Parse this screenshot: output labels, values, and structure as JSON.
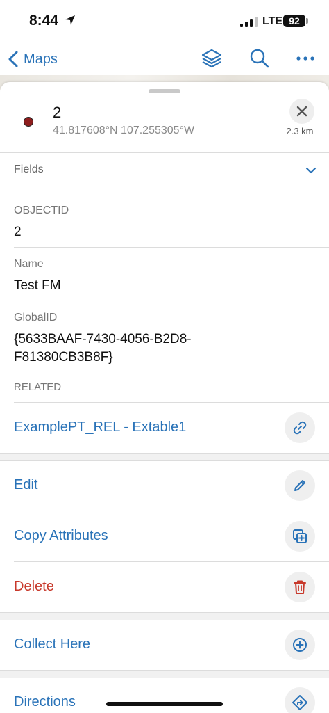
{
  "status_bar": {
    "time": "8:44",
    "network": "LTE",
    "battery": "92"
  },
  "nav": {
    "back_label": "Maps"
  },
  "feature": {
    "title": "2",
    "coordinates": "41.817608°N  107.255305°W",
    "distance": "2.3 km"
  },
  "fields_section": {
    "label": "Fields"
  },
  "fields": [
    {
      "label": "OBJECTID",
      "value": "2"
    },
    {
      "label": "Name",
      "value": "Test FM"
    },
    {
      "label": "GlobalID",
      "value_line1": "{5633BAAF-7430-4056-B2D8-",
      "value_line2": "F81380CB3B8F}"
    }
  ],
  "related": {
    "label": "RELATED",
    "item": "ExamplePT_REL - Extable1"
  },
  "actions": {
    "edit": "Edit",
    "copy_attributes": "Copy Attributes",
    "delete": "Delete",
    "collect_here": "Collect Here",
    "directions": "Directions"
  },
  "colors": {
    "accent": "#2a73b8",
    "danger": "#c8392b",
    "feature_symbol": "#8e1d1d"
  }
}
